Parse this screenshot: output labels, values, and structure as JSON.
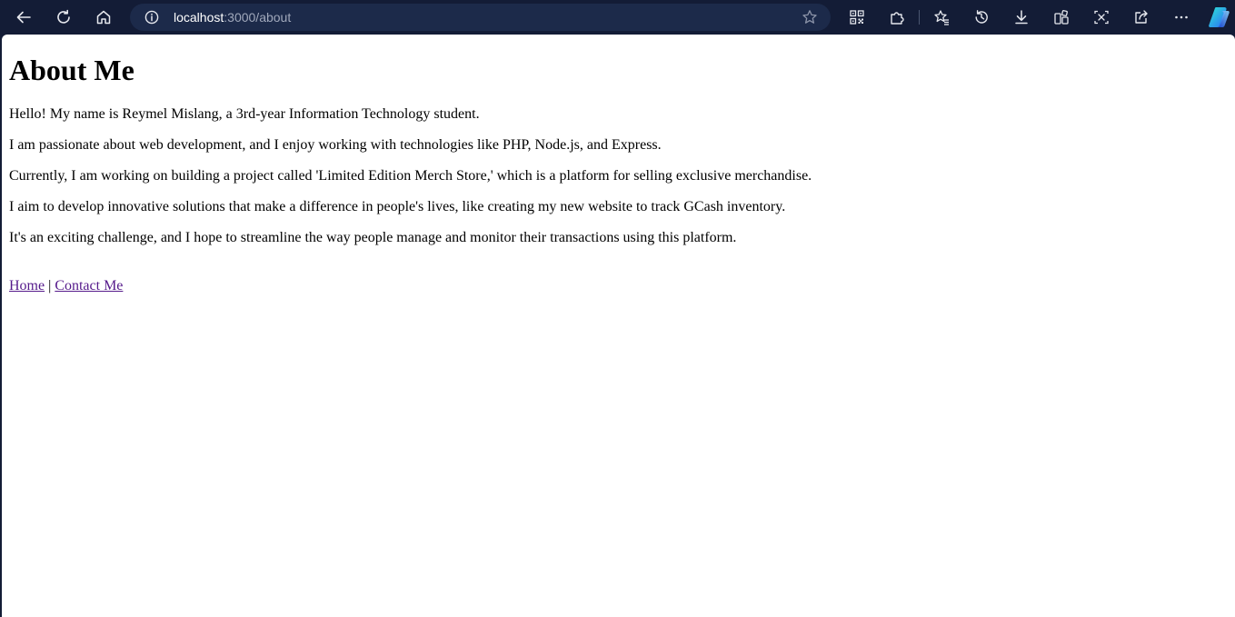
{
  "browser": {
    "url_host": "localhost",
    "url_path": ":3000/about",
    "colors": {
      "toolbar_bg": "#131c36",
      "address_bg": "#1c2a4a",
      "icon": "#e6e8ee"
    },
    "toolbar_icons": [
      "back-icon",
      "refresh-icon",
      "home-icon",
      "info-icon",
      "star-icon",
      "qr-code-icon",
      "extensions-icon",
      "favorites-icon",
      "history-icon",
      "downloads-icon",
      "collections-icon",
      "screenshot-icon",
      "share-icon",
      "more-icon",
      "copilot-icon"
    ]
  },
  "page": {
    "heading": "About Me",
    "paragraphs": [
      "Hello! My name is Reymel Mislang, a 3rd-year Information Technology student.",
      "I am passionate about web development, and I enjoy working with technologies like PHP, Node.js, and Express.",
      "Currently, I am working on building a project called 'Limited Edition Merch Store,' which is a platform for selling exclusive merchandise.",
      "I aim to develop innovative solutions that make a difference in people's lives, like creating my new website to track GCash inventory.",
      "It's an exciting challenge, and I hope to streamline the way people manage and monitor their transactions using this platform."
    ],
    "nav": {
      "home_label": "Home",
      "separator": "|",
      "contact_label": "Contact Me"
    },
    "colors": {
      "link_visited": "#551a8b",
      "text": "#000000",
      "background": "#ffffff"
    }
  }
}
